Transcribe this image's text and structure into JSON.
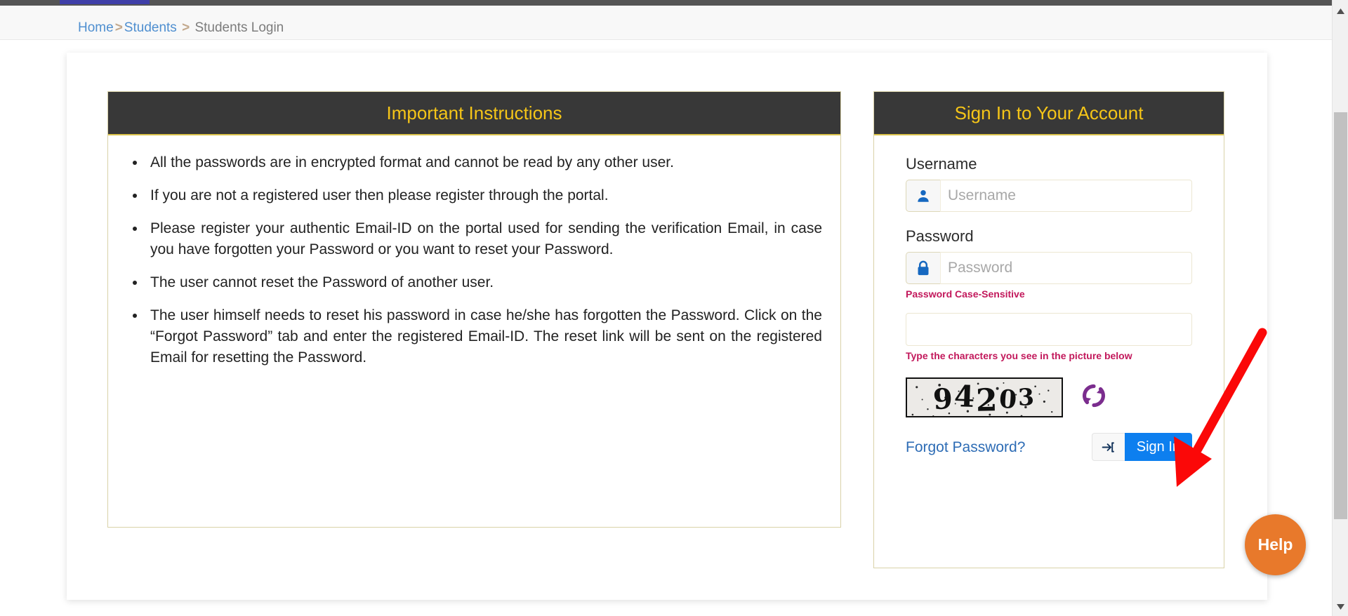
{
  "breadcrumb": {
    "items": [
      {
        "label": "Home",
        "type": "link"
      },
      {
        "label": "Students",
        "type": "link"
      },
      {
        "label": "Students Login",
        "type": "current"
      }
    ],
    "separator": ">"
  },
  "instructions_panel": {
    "title": "Important Instructions",
    "items": [
      "All the passwords are in encrypted format and cannot be read by any other user.",
      "If you are not a registered user then please register through the portal.",
      "Please register your authentic Email-ID on the portal used for sending the verification Email, in case you have forgotten your Password or you want to reset your Password.",
      "The user cannot reset the Password of another user.",
      "The user himself needs to reset his password in case he/she has forgotten the Password. Click on the “Forgot Password” tab and enter the registered Email-ID. The reset link will be sent on the registered Email for resetting the Password."
    ]
  },
  "signin_panel": {
    "title": "Sign In to Your Account",
    "username": {
      "label": "Username",
      "placeholder": "Username",
      "value": "",
      "icon": "user-icon"
    },
    "password": {
      "label": "Password",
      "placeholder": "Password",
      "value": "",
      "icon": "lock-icon",
      "hint": "Password Case-Sensitive"
    },
    "captcha": {
      "input_placeholder": "",
      "input_value": "",
      "hint": "Type the characters you see in the picture below",
      "code": "94203",
      "refresh_icon": "refresh-icon"
    },
    "forgot_password_label": "Forgot Password?",
    "signin_button_label": "Sign In",
    "signin_button_icon": "sign-in-arrow-icon"
  },
  "help": {
    "label": "Help"
  },
  "colors": {
    "panel_header_bg": "#383838",
    "panel_header_text": "#f5c518",
    "panel_border": "#d9d2a8",
    "accent_blue": "#0d7fef",
    "link_blue": "#2d6cb5",
    "hint_red": "#c2185b",
    "help_orange": "#e8792b",
    "annotation_red": "#fb0808",
    "icon_blue": "#1668c0",
    "refresh_purple": "#7b2d8e",
    "topbar_dark": "#555555",
    "topbar_progress": "#3f3fa8"
  }
}
